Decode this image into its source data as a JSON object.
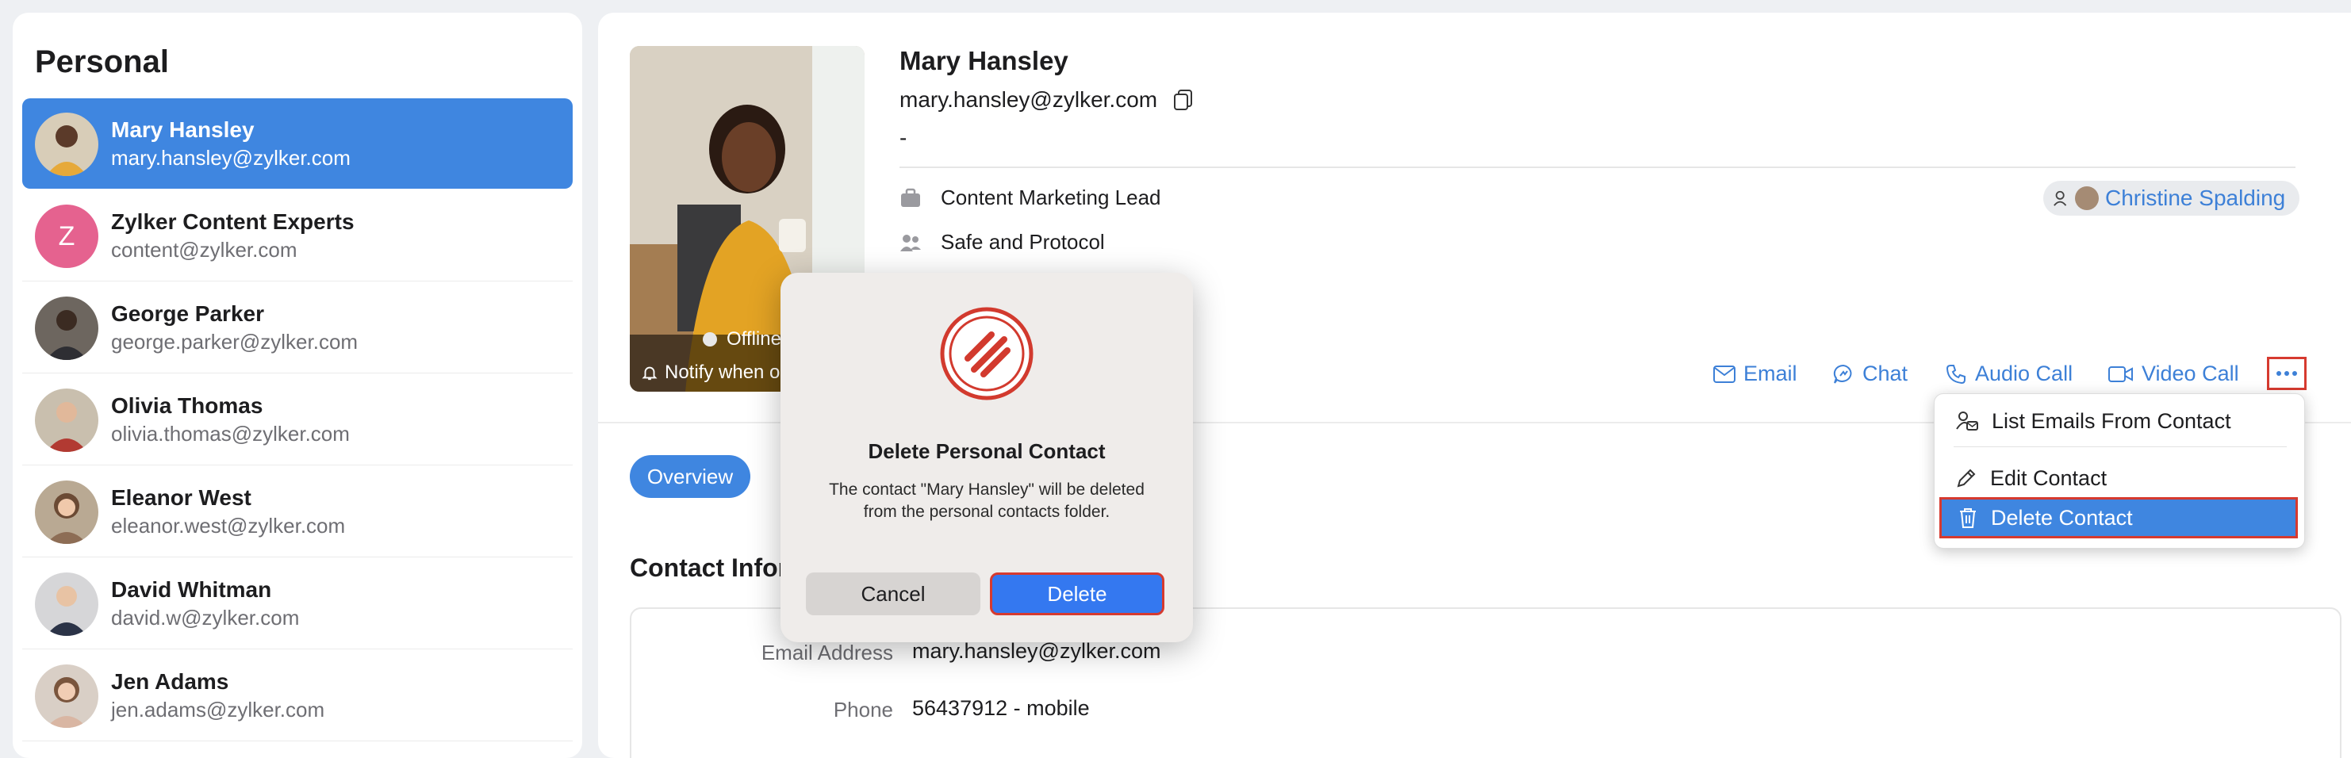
{
  "list": {
    "title": "Personal",
    "contacts": [
      {
        "name": "Mary Hansley",
        "email": "mary.hansley@zylker.com"
      },
      {
        "name": "Zylker Content Experts",
        "email": "content@zylker.com",
        "initial": "Z"
      },
      {
        "name": "George Parker",
        "email": "george.parker@zylker.com"
      },
      {
        "name": "Olivia Thomas",
        "email": "olivia.thomas@zylker.com"
      },
      {
        "name": "Eleanor West",
        "email": "eleanor.west@zylker.com"
      },
      {
        "name": "David Whitman",
        "email": "david.w@zylker.com"
      },
      {
        "name": "Jen Adams",
        "email": "jen.adams@zylker.com"
      }
    ]
  },
  "detail": {
    "name": "Mary Hansley",
    "email": "mary.hansley@zylker.com",
    "dash": "-",
    "job_title": "Content Marketing Lead",
    "department": "Safe and Protocol",
    "owner": "Christine Spalding",
    "status": "Offline",
    "notify": "Notify when online",
    "actions": {
      "email": "Email",
      "chat": "Chat",
      "audio": "Audio Call",
      "video": "Video Call"
    },
    "tab_overview": "Overview",
    "contact_info_heading": "Contact Information",
    "fields": [
      {
        "label": "Email Address",
        "value": "mary.hansley@zylker.com"
      },
      {
        "label": "Phone",
        "value": "56437912 - mobile"
      }
    ]
  },
  "menu": {
    "list_emails": "List Emails From Contact",
    "edit": "Edit Contact",
    "delete": "Delete Contact"
  },
  "dialog": {
    "title": "Delete Personal Contact",
    "message": "The contact \"Mary Hansley\" will be deleted from the personal contacts folder.",
    "cancel": "Cancel",
    "delete": "Delete"
  },
  "colors": {
    "accent": "#3f86e0",
    "highlight": "#d63a2f",
    "avatar_z": "#e5628f"
  }
}
